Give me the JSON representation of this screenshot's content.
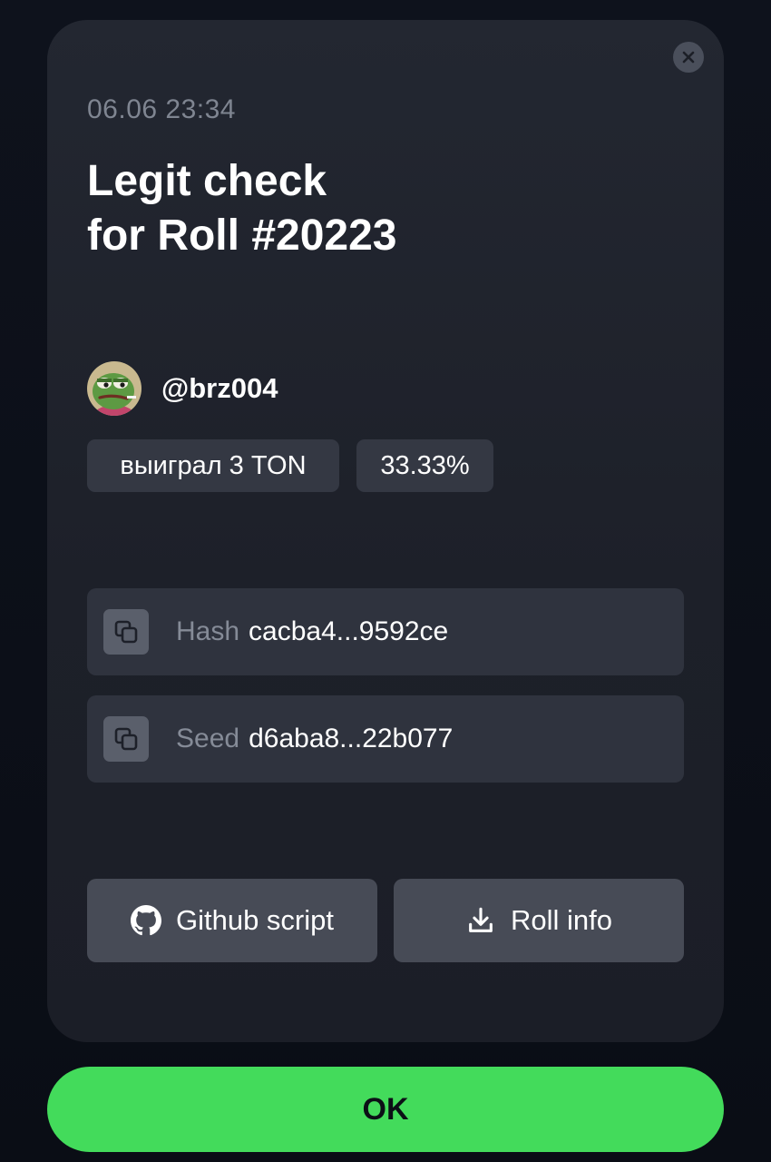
{
  "modal": {
    "date": "06.06 23:34",
    "title_line1": "Legit check",
    "title_line2": "for Roll #20223",
    "close_icon": "close-icon"
  },
  "user": {
    "username": "@brz004",
    "avatar_icon": "frog-avatar"
  },
  "chips": {
    "result": "выиграл 3 TON",
    "percent": "33.33%"
  },
  "hash": {
    "label": "Hash",
    "value": "cacba4...9592ce",
    "icon": "copy-icon"
  },
  "seed": {
    "label": "Seed",
    "value": "d6aba8...22b077",
    "icon": "copy-icon"
  },
  "buttons": {
    "github": "Github script",
    "github_icon": "github-icon",
    "roll_info": "Roll info",
    "roll_info_icon": "download-icon",
    "ok": "OK"
  },
  "colors": {
    "accent": "#43db5b",
    "card": "#1f222b",
    "chip": "#343843"
  }
}
